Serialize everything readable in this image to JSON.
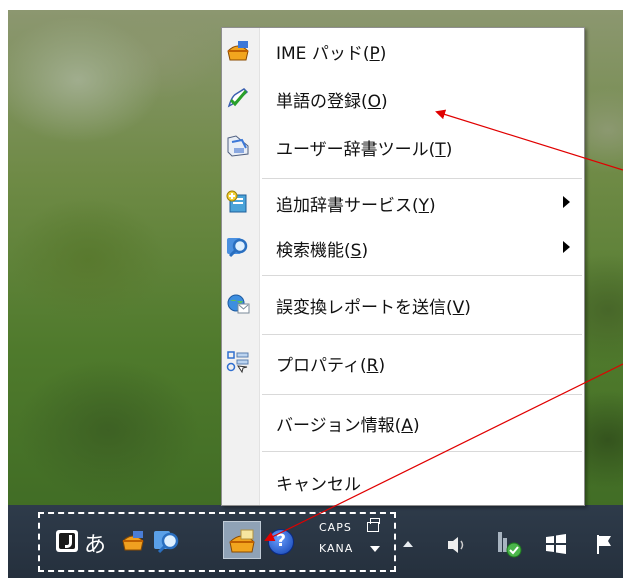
{
  "menu": {
    "items": [
      {
        "name": "ime-pad",
        "label": "IME パッド(",
        "key": "P",
        "suffix": ")",
        "icon": "ime-pad-icon",
        "has_submenu": false
      },
      {
        "name": "word-register",
        "label": "単語の登録(",
        "key": "O",
        "suffix": ")",
        "icon": "checkmark-pen-icon",
        "has_submenu": false
      },
      {
        "name": "user-dictionary-tool",
        "label": "ユーザー辞書ツール(",
        "key": "T",
        "suffix": ")",
        "icon": "dictionary-tool-icon",
        "has_submenu": false
      },
      {
        "name": "additional-dictionary-service",
        "label": "追加辞書サービス(",
        "key": "Y",
        "suffix": ")",
        "icon": "add-dictionary-icon",
        "has_submenu": true
      },
      {
        "name": "search-function",
        "label": "検索機能(",
        "key": "S",
        "suffix": ")",
        "icon": "search-function-icon",
        "has_submenu": true
      },
      {
        "name": "send-conversion-report",
        "label": "誤変換レポートを送信(",
        "key": "V",
        "suffix": ")",
        "icon": "report-globe-icon",
        "has_submenu": false
      },
      {
        "name": "properties",
        "label": "プロパティ(",
        "key": "R",
        "suffix": ")",
        "icon": "properties-icon",
        "has_submenu": false
      },
      {
        "name": "version-info",
        "label": "バージョン情報(",
        "key": "A",
        "suffix": ")",
        "icon": "",
        "has_submenu": false
      },
      {
        "name": "cancel",
        "label": "キャンセル",
        "key": "",
        "suffix": "",
        "icon": "",
        "has_submenu": false
      }
    ]
  },
  "taskbar": {
    "ime_mode_char": "あ",
    "caps_label": "CAPS",
    "kana_label": "KANA",
    "ime_icons": [
      "ime-j-icon",
      "hiragana-mode-icon",
      "ime-pad-tray-icon",
      "search-tray-icon",
      "dictionary-tray-icon",
      "help-icon",
      "caps-kana-indicator",
      "options-chevron-icon"
    ],
    "tray_icons": [
      "show-hidden-icons-arrow",
      "speaker-icon",
      "network-icon",
      "windows-icon",
      "flag-icon"
    ]
  },
  "colors": {
    "arrow": "#e00000",
    "taskbar": "#2a3644",
    "menu_bg": "#ffffff",
    "menu_border": "#8f8f8f"
  }
}
